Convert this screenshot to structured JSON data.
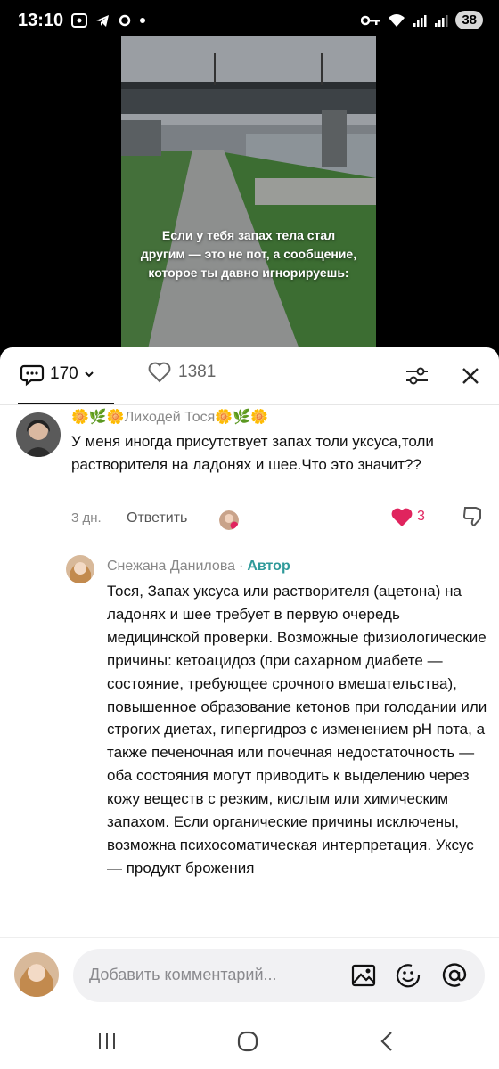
{
  "status_bar": {
    "time": "13:10",
    "battery": "38"
  },
  "video": {
    "caption": "Если у тебя запах тела стал другим — это не пот, а сообщение, которое ты давно игнорируешь:"
  },
  "header": {
    "comments_count": "170",
    "likes_count": "1381"
  },
  "comments": [
    {
      "author": "🌼🌿🌼Лиходей Тося🌼🌿🌼",
      "text": "У меня иногда присутствует запах толи уксуса,толи растворителя на ладонях и шее.Что это значит??",
      "time": "3 дн.",
      "reply_label": "Ответить",
      "likes": "3"
    }
  ],
  "reply": {
    "author": "Снежана Данилова",
    "separator": "·",
    "badge": "Автор",
    "text": "Тося, Запах уксуса или растворителя (ацетона) на ладонях и шее требует в первую очередь медицинской проверки. Возможные физиологические причины: кетоацидоз (при сахарном диабете — состояние, требующее срочного вмешательства), повышенное образование кетонов при голодании или строгих диетах, гипергидроз с изменением pH пота, а также печеночная или почечная недостаточность — оба состояния могут приводить к выделению через кожу веществ с резким, кислым или химическим запахом. Если органические причины исключены, возможна психосоматическая интерпретация. Уксус — продукт брожения"
  },
  "input": {
    "placeholder": "Добавить комментарий..."
  },
  "colors": {
    "accent_teal": "#2f9a9a",
    "like_red": "#e0245e"
  }
}
